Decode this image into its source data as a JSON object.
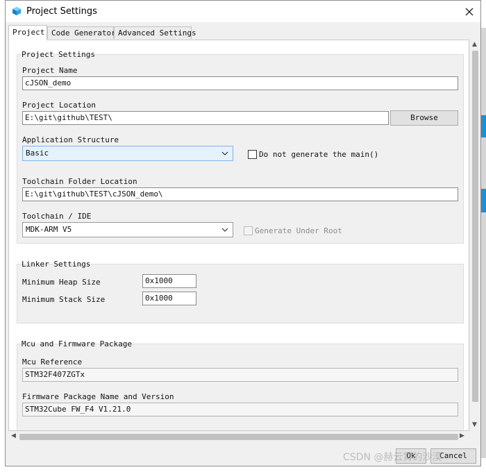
{
  "window": {
    "title": "Project Settings"
  },
  "tabs": [
    {
      "label": "Project",
      "active": true
    },
    {
      "label": "Code Generator",
      "active": false
    },
    {
      "label": "Advanced Settings",
      "active": false
    }
  ],
  "project_settings": {
    "legend": "Project Settings",
    "project_name_label": "Project Name",
    "project_name_value": "cJSON_demo",
    "project_location_label": "Project Location",
    "project_location_value": "E:\\git\\github\\TEST\\",
    "browse_label": "Browse",
    "app_structure_label": "Application Structure",
    "app_structure_value": "Basic",
    "no_main_label": "Do not generate the main()",
    "toolchain_folder_label": "Toolchain Folder Location",
    "toolchain_folder_value": "E:\\git\\github\\TEST\\cJSON_demo\\",
    "toolchain_ide_label": "Toolchain / IDE",
    "toolchain_ide_value": "MDK-ARM V5",
    "generate_under_root_label": "Generate Under Root"
  },
  "linker_settings": {
    "legend": "Linker Settings",
    "heap_label": "Minimum Heap Size",
    "heap_value": "0x1000",
    "stack_label": "Minimum Stack Size",
    "stack_value": "0x1000"
  },
  "mcu_firmware": {
    "legend": "Mcu and Firmware Package",
    "mcu_ref_label": "Mcu Reference",
    "mcu_ref_value": "STM32F407ZGTx",
    "fw_label": "Firmware Package Name and Version",
    "fw_value": "STM32Cube FW_F4 V1.21.0"
  },
  "footer": {
    "ok_label": "Ok",
    "cancel_label": "Cancel"
  },
  "watermark": "CSDN @赫云霄的沙漠",
  "colors": {
    "accent": "#1e8fd6",
    "selected_bg": "#e5f1fb",
    "dialog_bg": "#f0f0f0"
  }
}
